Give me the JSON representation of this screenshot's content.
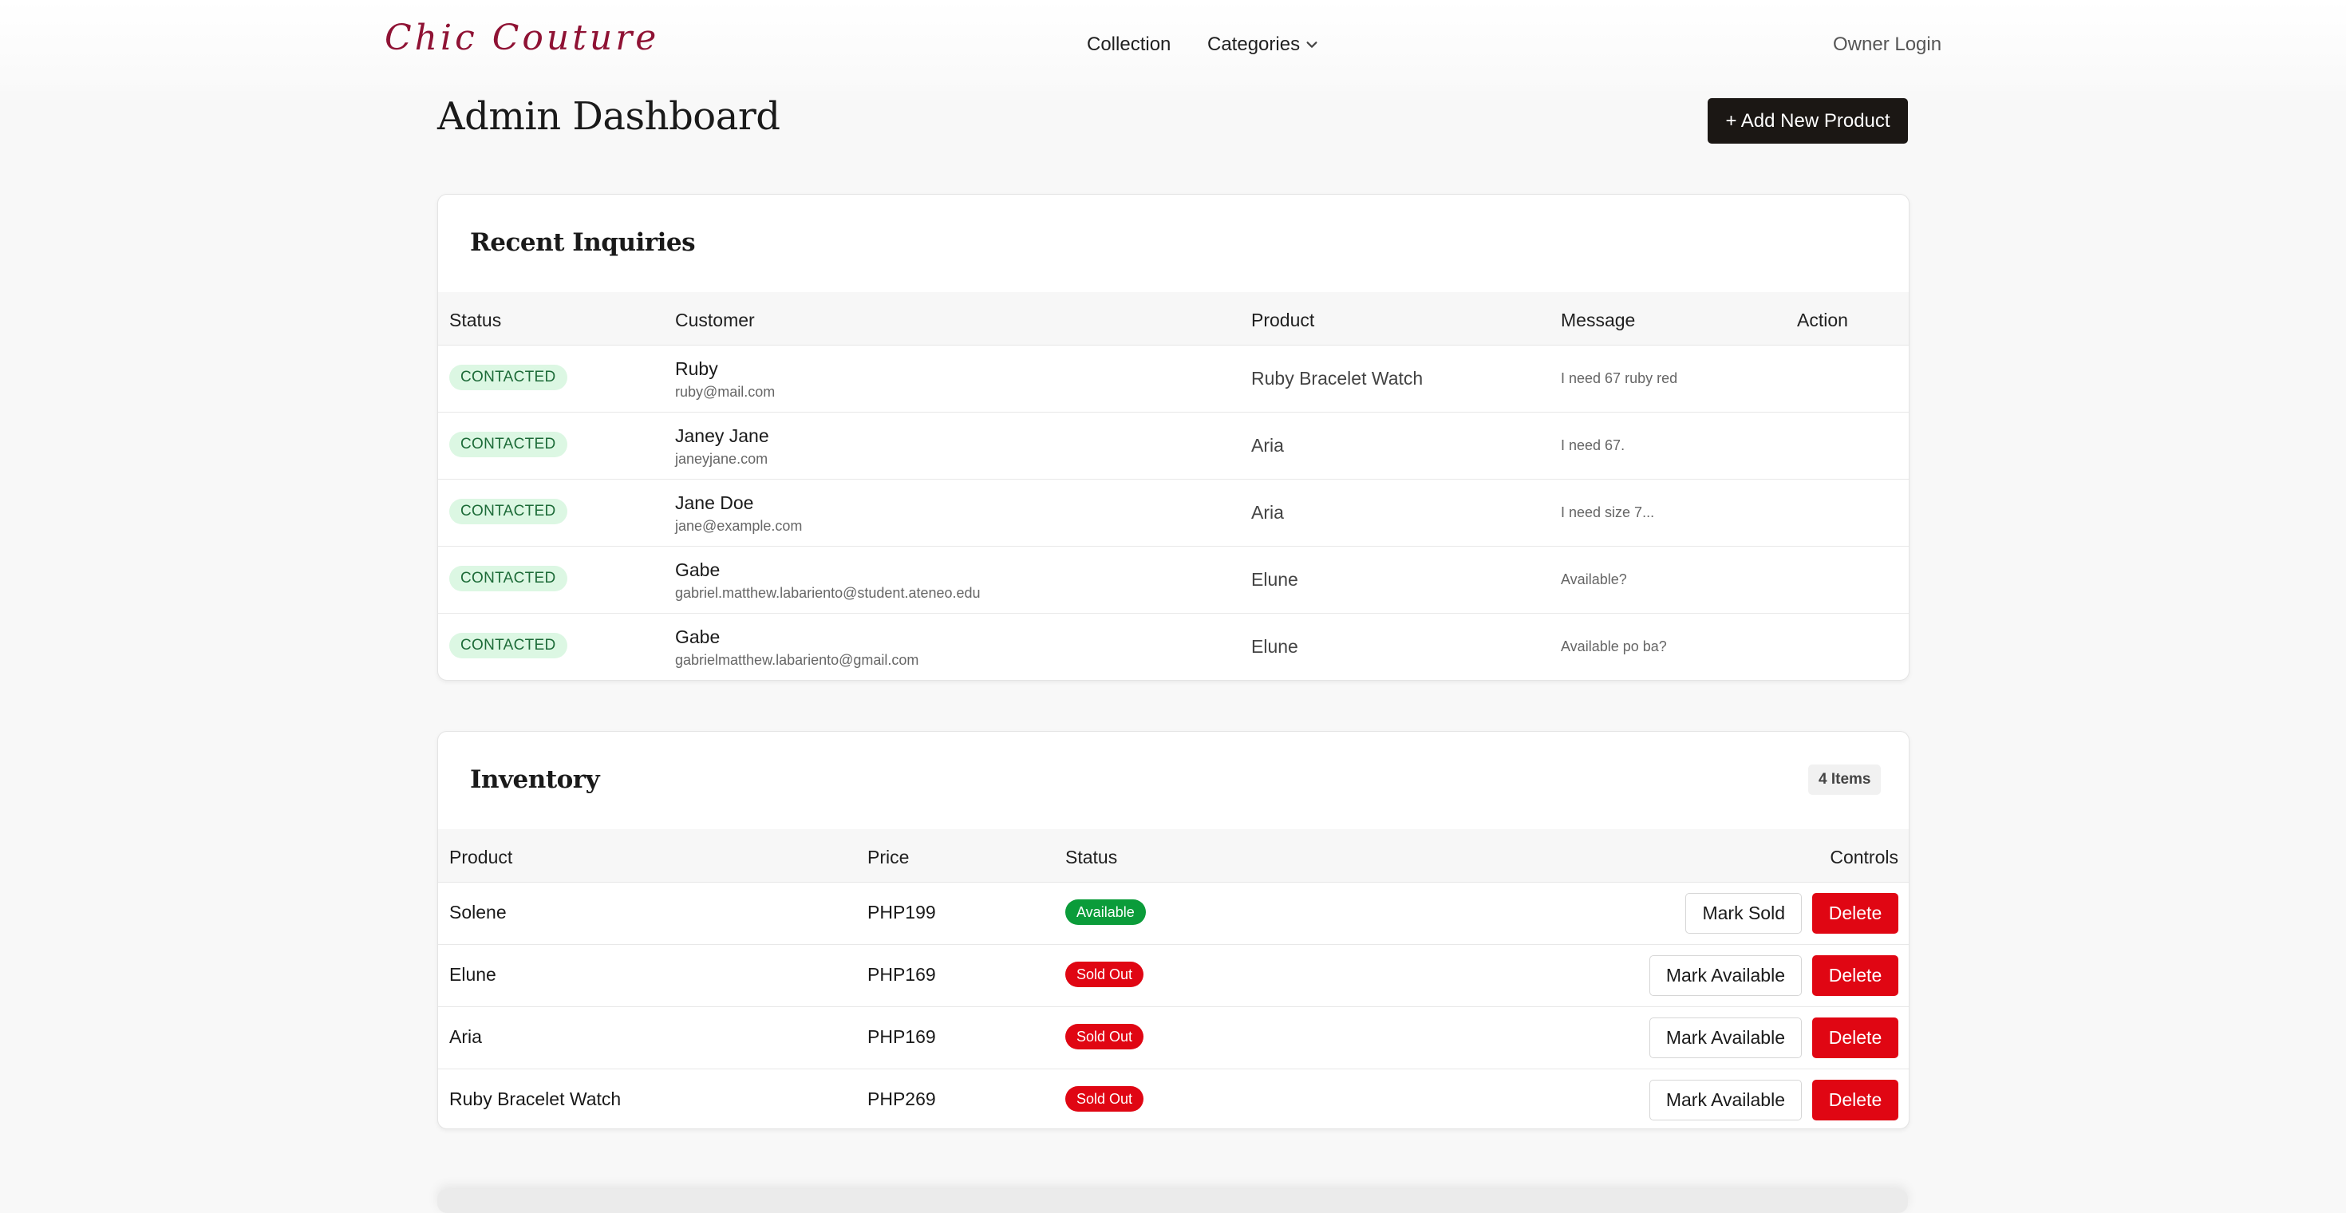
{
  "header": {
    "brand": "Chic Couture",
    "nav": {
      "collection": "Collection",
      "categories": "Categories"
    },
    "owner_login": "Owner Login"
  },
  "page": {
    "title": "Admin Dashboard",
    "add_button": "+ Add New Product"
  },
  "inquiries": {
    "title": "Recent Inquiries",
    "columns": {
      "status": "Status",
      "customer": "Customer",
      "product": "Product",
      "message": "Message",
      "action": "Action"
    },
    "rows": [
      {
        "status": "CONTACTED",
        "name": "Ruby",
        "email": "ruby@mail.com",
        "product": "Ruby Bracelet Watch",
        "message": "I need 67 ruby red"
      },
      {
        "status": "CONTACTED",
        "name": "Janey Jane",
        "email": "janeyjane.com",
        "product": "Aria",
        "message": "I need 67."
      },
      {
        "status": "CONTACTED",
        "name": "Jane Doe",
        "email": "jane@example.com",
        "product": "Aria",
        "message": "I need size 7..."
      },
      {
        "status": "CONTACTED",
        "name": "Gabe",
        "email": "gabriel.matthew.labariento@student.ateneo.edu",
        "product": "Elune",
        "message": "Available?"
      },
      {
        "status": "CONTACTED",
        "name": "Gabe",
        "email": "gabrielmatthew.labariento@gmail.com",
        "product": "Elune",
        "message": "Available po ba?"
      }
    ]
  },
  "inventory": {
    "title": "Inventory",
    "count_badge": "4 Items",
    "columns": {
      "product": "Product",
      "price": "Price",
      "status": "Status",
      "controls": "Controls"
    },
    "rows": [
      {
        "product": "Solene",
        "price": "PHP199",
        "status": "Available",
        "toggle_label": "Mark Sold",
        "delete_label": "Delete"
      },
      {
        "product": "Elune",
        "price": "PHP169",
        "status": "Sold Out",
        "toggle_label": "Mark Available",
        "delete_label": "Delete"
      },
      {
        "product": "Aria",
        "price": "PHP169",
        "status": "Sold Out",
        "toggle_label": "Mark Available",
        "delete_label": "Delete"
      },
      {
        "product": "Ruby Bracelet Watch",
        "price": "PHP269",
        "status": "Sold Out",
        "toggle_label": "Mark Available",
        "delete_label": "Delete"
      }
    ]
  },
  "colors": {
    "brand": "#8f1234",
    "primary_button": "#1b1714",
    "available": "#0b9c3a",
    "sold_out": "#e00613",
    "delete": "#e00613",
    "contacted_bg": "#dcf7e3",
    "contacted_text": "#1d6b38"
  },
  "icons": {
    "categories_dropdown": "chevron-down-icon"
  }
}
